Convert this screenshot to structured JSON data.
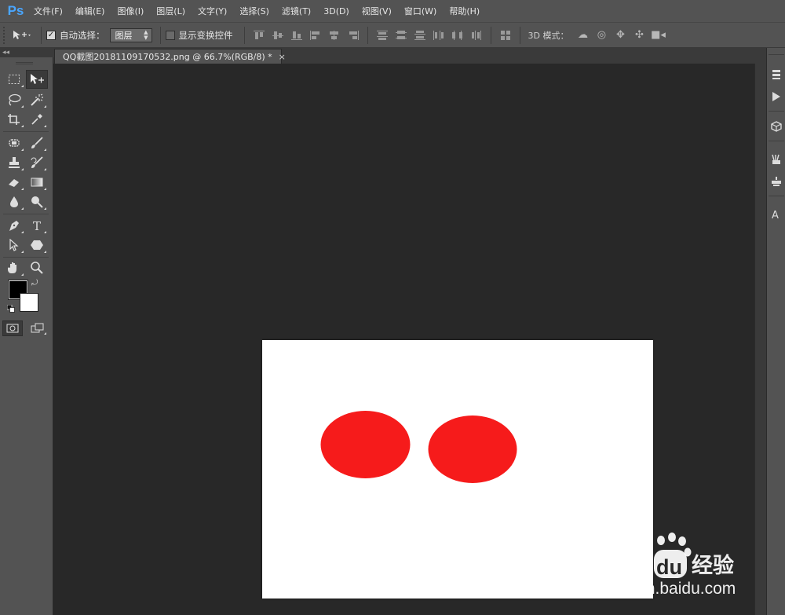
{
  "app": {
    "logo": "Ps"
  },
  "menu": [
    "文件(F)",
    "编辑(E)",
    "图像(I)",
    "图层(L)",
    "文字(Y)",
    "选择(S)",
    "滤镜(T)",
    "3D(D)",
    "视图(V)",
    "窗口(W)",
    "帮助(H)"
  ],
  "options": {
    "auto_select_label": "自动选择：",
    "auto_select_checked": true,
    "auto_select_target": "图层",
    "show_transform_label": "显示变换控件",
    "show_transform_checked": false,
    "mode3d_label": "3D 模式："
  },
  "document": {
    "tab_title": "QQ截图20181109170532.png @ 66.7%(RGB/8) *",
    "close_glyph": "×",
    "canvas_background": "#ffffff",
    "shape_color": "#f61b1b",
    "shapes": [
      {
        "name": "red-ellipse-left"
      },
      {
        "name": "red-ellipse-right"
      }
    ]
  },
  "tools_panel": {
    "collapse_glyph": "◂◂"
  },
  "colors": {
    "foreground": "#000000",
    "background": "#ffffff",
    "chrome": "#535353",
    "workspace": "#282828",
    "ps_blue": "#4aa6ff"
  },
  "watermark": {
    "brand_left": "Bai",
    "brand_right": "du",
    "brand_cn": "经验",
    "url": "jingyan.baidu.com"
  }
}
